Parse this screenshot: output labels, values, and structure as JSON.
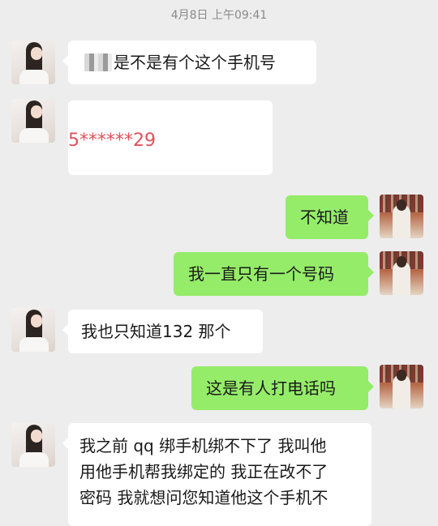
{
  "timestamp": "4月8日 上午09:41",
  "messages": [
    {
      "side": "in",
      "text": "是不是有个这个手机号"
    },
    {
      "side": "in",
      "image_text": "5******29"
    },
    {
      "side": "out",
      "text": "不知道"
    },
    {
      "side": "out",
      "text": "我一直只有一个号码"
    },
    {
      "side": "in",
      "text": "我也只知道132 那个"
    },
    {
      "side": "out",
      "text": "这是有人打电话吗"
    },
    {
      "side": "in",
      "lines": [
        "我之前 qq 绑手机绑不下了  我叫他",
        "用他手机帮我绑定的 我正在改不了",
        "密码 我就想问您知道他这个手机不"
      ]
    }
  ],
  "colors": {
    "background": "#ededed",
    "incoming": "#ffffff",
    "outgoing": "#95ec69",
    "masked_number": "#e0525b"
  }
}
